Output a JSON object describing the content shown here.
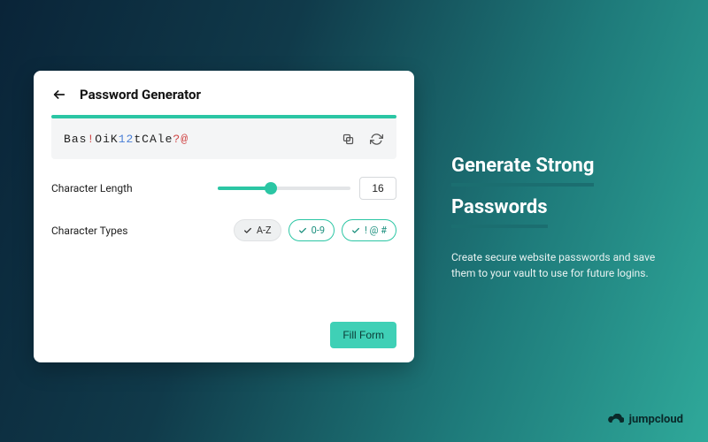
{
  "card": {
    "title": "Password Generator",
    "password": "Bas!OiK12tCAle?@",
    "length_label": "Character Length",
    "length_value": "16",
    "types_label": "Character Types",
    "chips": {
      "alpha": "A-Z",
      "digits": "0-9",
      "symbols": "! @ #"
    },
    "fill_label": "Fill Form"
  },
  "promo": {
    "heading_line1": "Generate Strong",
    "heading_line2": "Passwords",
    "description": "Create secure website passwords and save them to your vault to use for future logins."
  },
  "brand": {
    "name": "jumpcloud"
  },
  "colors": {
    "accent": "#2bc6a4"
  }
}
